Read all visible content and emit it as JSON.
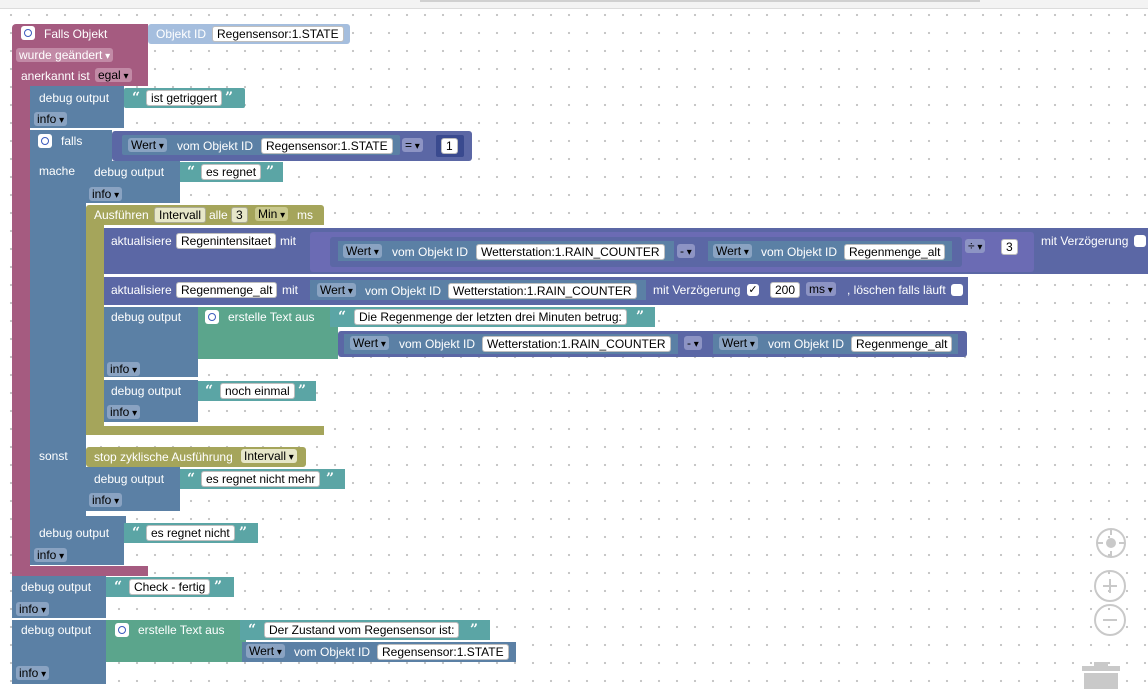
{
  "trigger": {
    "title": "Falls Objekt",
    "changed": "wurde geändert",
    "ack_label": "anerkannt ist",
    "ack_value": "egal",
    "objid_label": "Objekt ID",
    "objid_value": "Regensensor:1.STATE"
  },
  "common": {
    "debug": "debug output",
    "info": "info",
    "wert": "Wert",
    "vom": "vom Objekt ID",
    "quote_open": "“",
    "quote_close": "”"
  },
  "dbg1": "ist getriggert",
  "if_block": {
    "falls": "falls",
    "mache": "mache",
    "sonst": "sonst",
    "cond_obj": "Regensensor:1.STATE",
    "cond_op": "=",
    "cond_val": "1"
  },
  "dbg2": "es regnet",
  "interval": {
    "ausfuehren": "Ausführen",
    "interval_name": "Intervall",
    "alle": "alle",
    "value": "3",
    "unit": "Min",
    "ms": "ms"
  },
  "update1": {
    "label": "aktualisiere",
    "target": "Regenintensitaet",
    "mit": "mit",
    "obj_a": "Wetterstation:1.RAIN_COUNTER",
    "minus": "-",
    "obj_b": "Regenmenge_alt",
    "div": "÷",
    "divisor": "3",
    "delay_label": "mit Verzögerung"
  },
  "update2": {
    "label": "aktualisiere",
    "target": "Regenmenge_alt",
    "mit": "mit",
    "obj": "Wetterstation:1.RAIN_COUNTER",
    "delay_label": "mit Verzögerung",
    "delay_checked": "✓",
    "delay_value": "200",
    "delay_unit": "ms",
    "clear_label": ", löschen falls läuft"
  },
  "text_block1": {
    "label": "erstelle Text aus",
    "text": "Die Regenmenge der letzten drei Minuten betrug:",
    "obj_a": "Wetterstation:1.RAIN_COUNTER",
    "minus": "-",
    "obj_b": "Regenmenge_alt"
  },
  "dbg4": "noch einmal",
  "stop_block": {
    "label": "stop zyklische Ausführung",
    "value": "Intervall"
  },
  "dbg5": "es regnet nicht mehr",
  "dbg6": "es regnet nicht",
  "dbg7": "Check - fertig",
  "text_block2": {
    "label": "erstelle Text aus",
    "text": "Der Zustand vom Regensensor ist:",
    "obj": "Regensensor:1.STATE"
  },
  "colors": {
    "trigger": "#a55b80",
    "debug": "#5b80a5",
    "interval": "#a5a55b",
    "text": "#5ba58c",
    "update": "#5b67a5",
    "string": "#5ba5a5",
    "math": "#6b6bb4"
  },
  "icons": [
    "gear-icon",
    "center-icon",
    "zoom-in-icon",
    "zoom-out-icon",
    "trash-icon"
  ]
}
